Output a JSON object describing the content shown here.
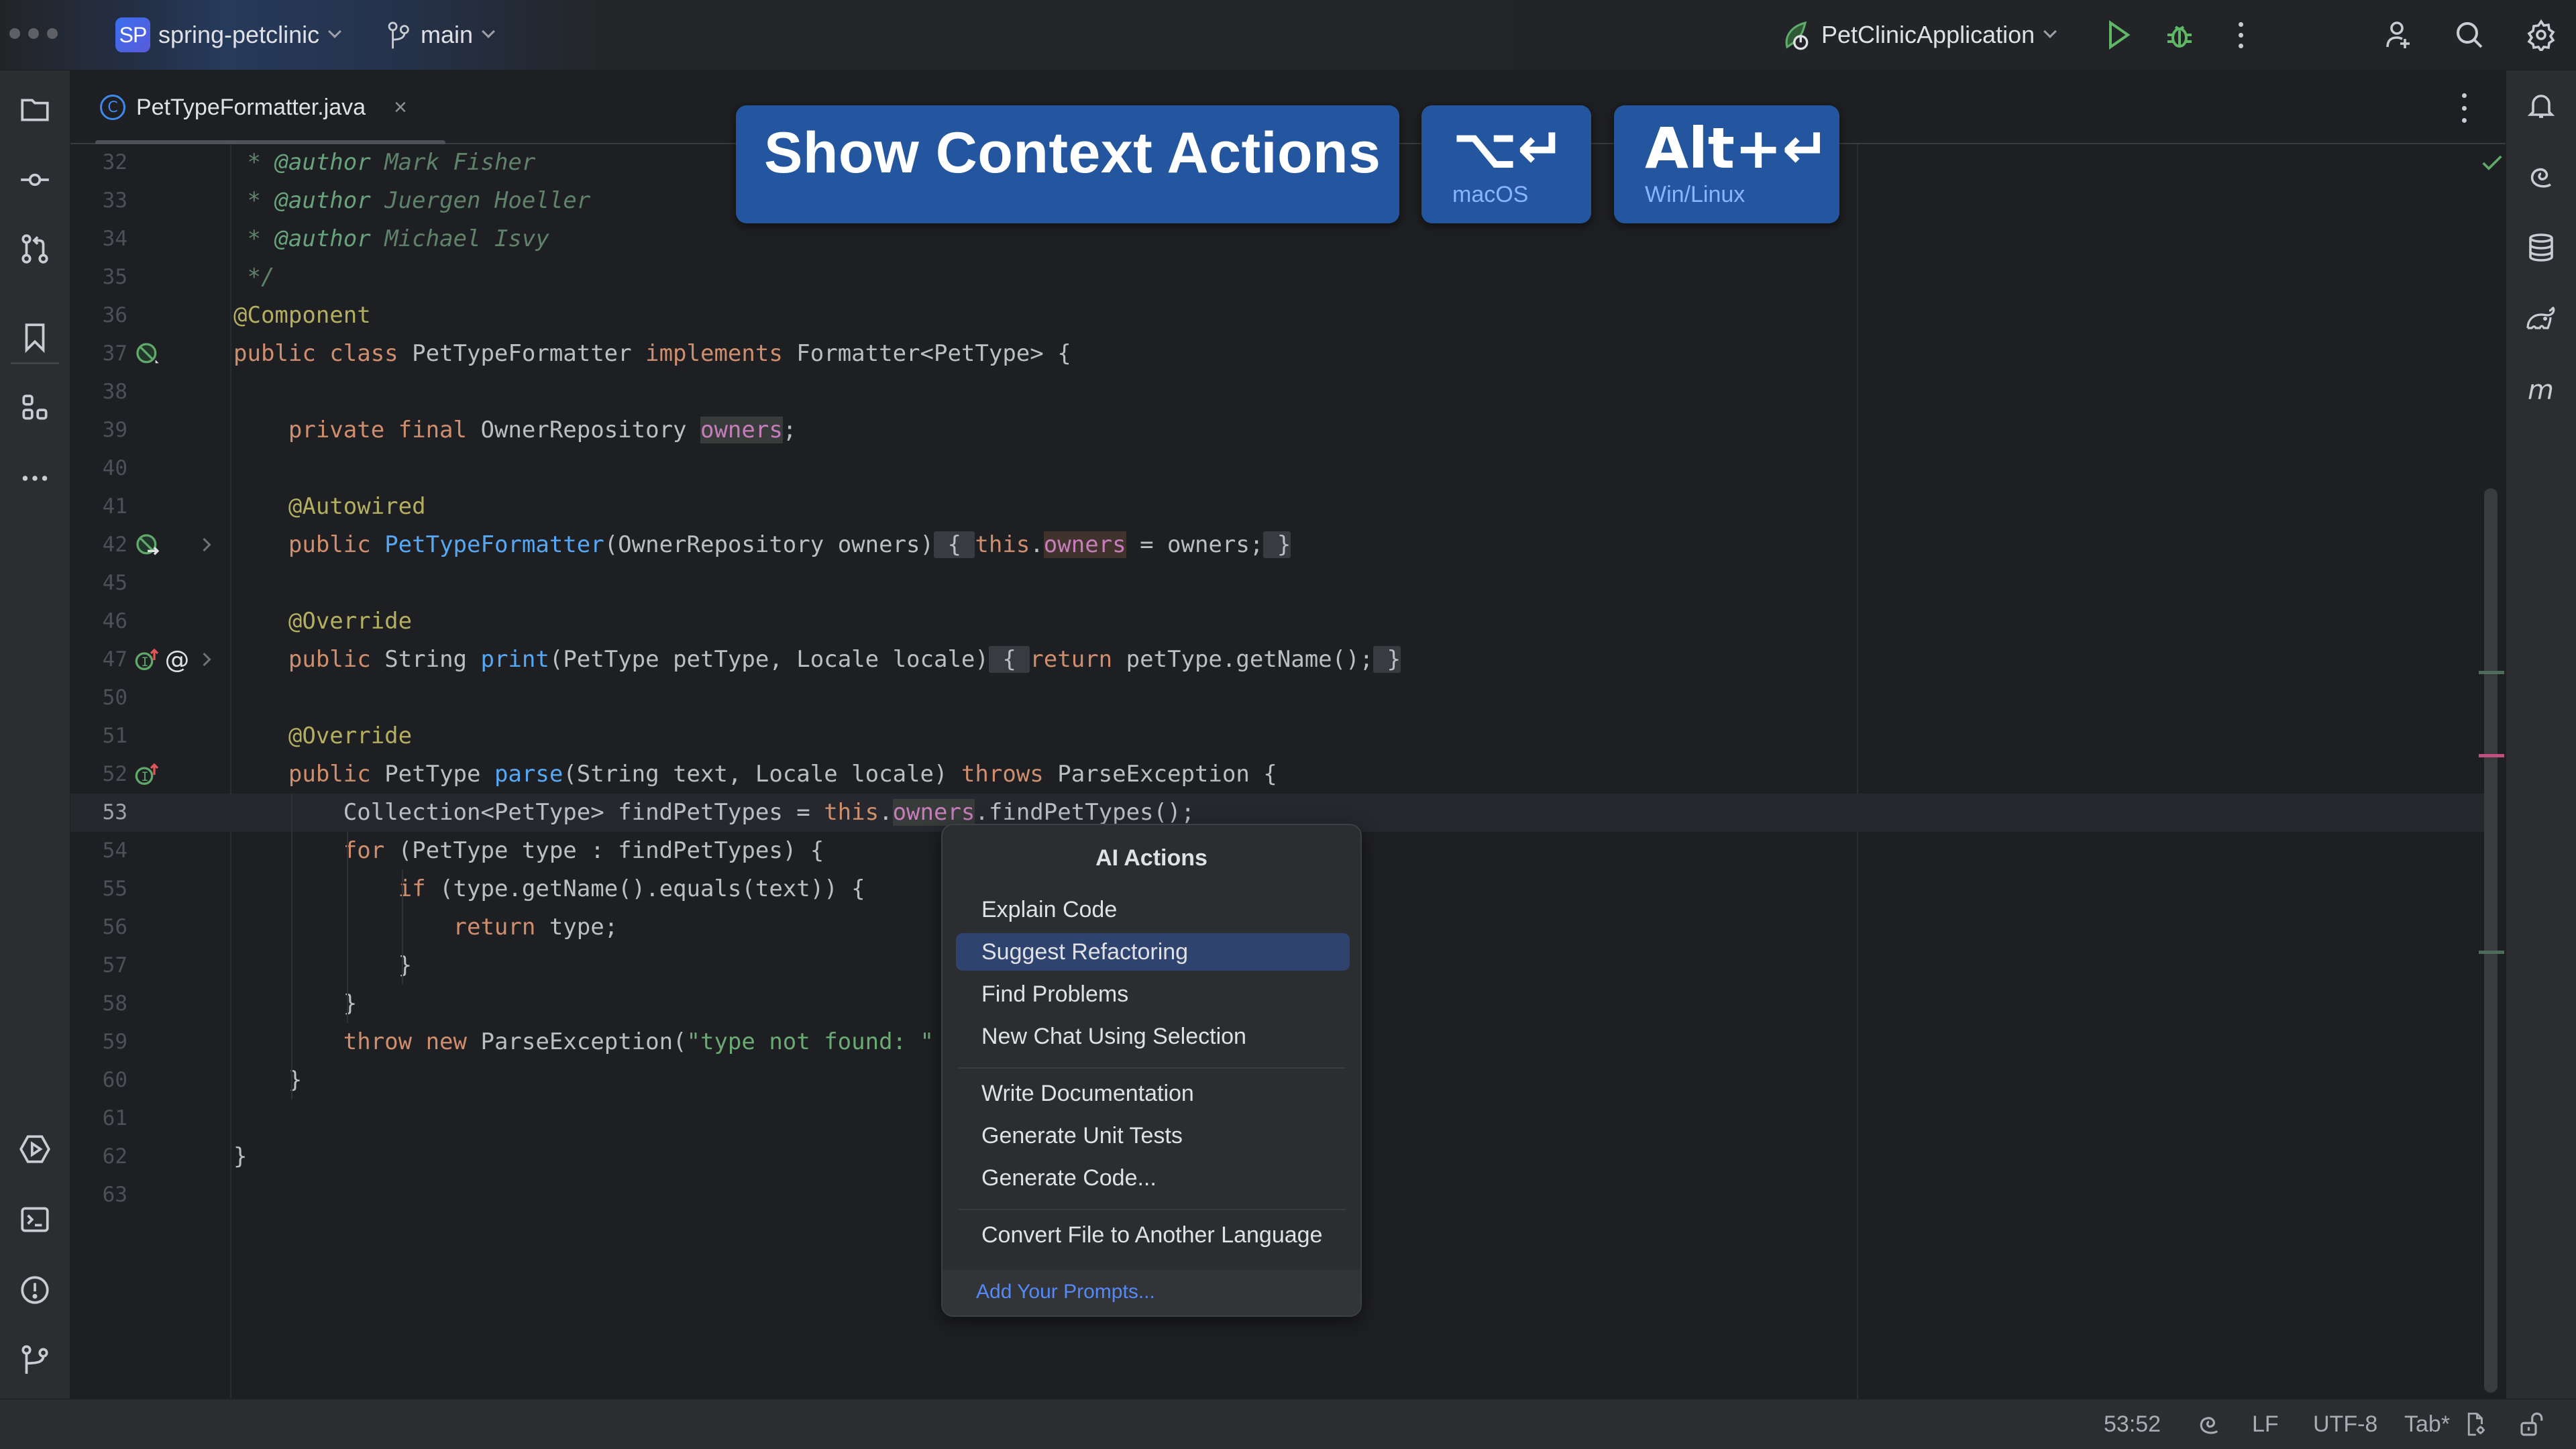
{
  "titlebar": {
    "project_badge": "SP",
    "project_name": "spring-petclinic",
    "branch": "main",
    "run_config": "PetClinicApplication",
    "icons": [
      "run-icon",
      "debug-icon",
      "more-vertical-icon",
      "add-user-icon",
      "search-icon",
      "settings-gear-icon"
    ]
  },
  "left_toolbar": {
    "top": [
      "project-folder-icon",
      "commit-icon",
      "pull-requests-icon",
      "bookmarks-icon",
      "structure-icon",
      "more-tools-icon"
    ],
    "bottom": [
      "run-services-icon",
      "terminal-icon",
      "problems-icon",
      "git-icon"
    ]
  },
  "right_toolbar": [
    "notifications-bell-icon",
    "ai-assistant-icon",
    "database-icon",
    "gradle-icon",
    "maven-icon"
  ],
  "editor": {
    "tab": {
      "icon": "C",
      "filename": "PetTypeFormatter.java",
      "close": "×"
    },
    "current_line": "53",
    "lines": [
      {
        "n": "32",
        "tokens": [
          [
            "cm",
            " * "
          ],
          [
            "cmtag",
            "@author"
          ],
          [
            "cm",
            " Mark Fisher"
          ]
        ]
      },
      {
        "n": "33",
        "tokens": [
          [
            "cm",
            " * "
          ],
          [
            "cmtag",
            "@author"
          ],
          [
            "cm",
            " Juergen Hoeller"
          ]
        ]
      },
      {
        "n": "34",
        "tokens": [
          [
            "cm",
            " * "
          ],
          [
            "cmtag",
            "@author"
          ],
          [
            "cm",
            " Michael Isvy"
          ]
        ]
      },
      {
        "n": "35",
        "tokens": [
          [
            "cm",
            " */"
          ]
        ]
      },
      {
        "n": "36",
        "tokens": [
          [
            "an",
            "@Component"
          ]
        ]
      },
      {
        "n": "37",
        "gutter": [
          "bean-icon"
        ],
        "tokens": [
          [
            "k",
            "public class "
          ],
          [
            "",
            "PetTypeFormatter "
          ],
          [
            "k",
            "implements "
          ],
          [
            "",
            "Formatter<PetType> {"
          ]
        ]
      },
      {
        "n": "38",
        "tokens": []
      },
      {
        "n": "39",
        "tokens": [
          [
            "",
            "    "
          ],
          [
            "k",
            "private final "
          ],
          [
            "",
            "OwnerRepository "
          ],
          [
            "fld hl-read",
            "owners"
          ],
          [
            "",
            ";"
          ]
        ]
      },
      {
        "n": "40",
        "tokens": []
      },
      {
        "n": "41",
        "tokens": [
          [
            "",
            "    "
          ],
          [
            "an",
            "@Autowired"
          ]
        ]
      },
      {
        "n": "42",
        "gutter": [
          "bean-inject-icon"
        ],
        "fold": true,
        "tokens": [
          [
            "",
            "    "
          ],
          [
            "k",
            "public "
          ],
          [
            "fn",
            "PetTypeFormatter"
          ],
          [
            "",
            "(OwnerRepository owners)"
          ],
          [
            "hl-fold",
            " { "
          ],
          [
            "k",
            "this"
          ],
          [
            "",
            "."
          ],
          [
            "fld hl-write",
            "owners"
          ],
          [
            "",
            " = owners;"
          ],
          [
            "hl-fold",
            " }"
          ]
        ]
      },
      {
        "n": "45",
        "tokens": []
      },
      {
        "n": "46",
        "tokens": [
          [
            "",
            "    "
          ],
          [
            "an",
            "@Override"
          ]
        ]
      },
      {
        "n": "47",
        "gutter": [
          "implements-icon",
          "annotation-icon"
        ],
        "fold": true,
        "tokens": [
          [
            "",
            "    "
          ],
          [
            "k",
            "public "
          ],
          [
            "",
            "String "
          ],
          [
            "fn",
            "print"
          ],
          [
            "",
            "(PetType petType, Locale locale)"
          ],
          [
            "hl-fold",
            " { "
          ],
          [
            "k",
            "return "
          ],
          [
            "",
            "petType.getName();"
          ],
          [
            "hl-fold",
            " }"
          ]
        ]
      },
      {
        "n": "50",
        "tokens": []
      },
      {
        "n": "51",
        "tokens": [
          [
            "",
            "    "
          ],
          [
            "an",
            "@Override"
          ]
        ]
      },
      {
        "n": "52",
        "gutter": [
          "implements-icon"
        ],
        "tokens": [
          [
            "",
            "    "
          ],
          [
            "k",
            "public "
          ],
          [
            "",
            "PetType "
          ],
          [
            "fn",
            "parse"
          ],
          [
            "",
            "(String text, Locale locale) "
          ],
          [
            "k",
            "throws "
          ],
          [
            "",
            "ParseException {"
          ]
        ]
      },
      {
        "n": "53",
        "tokens": [
          [
            "",
            "        Collection<PetType> findPetTypes = "
          ],
          [
            "k",
            "this"
          ],
          [
            "",
            "."
          ],
          [
            "fld hl-read",
            "owners"
          ],
          [
            "",
            ".findPetTypes();"
          ]
        ]
      },
      {
        "n": "54",
        "tokens": [
          [
            "",
            "        "
          ],
          [
            "k",
            "for "
          ],
          [
            "",
            "(PetType type : findPetTypes) {"
          ]
        ]
      },
      {
        "n": "55",
        "tokens": [
          [
            "",
            "            "
          ],
          [
            "k",
            "if "
          ],
          [
            "",
            "(type.getName().equals(text)) {"
          ]
        ]
      },
      {
        "n": "56",
        "tokens": [
          [
            "",
            "                "
          ],
          [
            "k",
            "return "
          ],
          [
            "",
            "type;"
          ]
        ]
      },
      {
        "n": "57",
        "tokens": [
          [
            "",
            "            }"
          ]
        ]
      },
      {
        "n": "58",
        "tokens": [
          [
            "",
            "        }"
          ]
        ]
      },
      {
        "n": "59",
        "tokens": [
          [
            "",
            "        "
          ],
          [
            "k",
            "throw new "
          ],
          [
            "",
            "ParseException("
          ],
          [
            "str",
            "\"type not found: \""
          ]
        ]
      },
      {
        "n": "60",
        "tokens": [
          [
            "",
            "    }"
          ]
        ]
      },
      {
        "n": "61",
        "tokens": []
      },
      {
        "n": "62",
        "tokens": [
          [
            "",
            "}"
          ]
        ]
      },
      {
        "n": "63",
        "tokens": []
      }
    ]
  },
  "overlay": {
    "title": "Show Context Actions",
    "mac_shortcut": "⌥↵",
    "mac_label": "macOS",
    "win_shortcut": "Alt+↵",
    "win_label": "Win/Linux"
  },
  "ai_popup": {
    "title": "AI Actions",
    "groups": [
      [
        "Explain Code",
        "Suggest Refactoring",
        "Find Problems",
        "New Chat Using Selection"
      ],
      [
        "Write Documentation",
        "Generate Unit Tests",
        "Generate Code..."
      ],
      [
        "Convert File to Another Language"
      ]
    ],
    "selected": "Suggest Refactoring",
    "footer": "Add Your Prompts..."
  },
  "statusbar": {
    "position": "53:52",
    "line_separator": "LF",
    "encoding": "UTF-8",
    "indent": "Tab*"
  },
  "colors": {
    "accent": "#2456a0",
    "selection": "#2e436e",
    "link": "#548af7",
    "keyword": "#cf8e6d",
    "annotation": "#b3ae60",
    "function": "#56a8f5",
    "field": "#c77dbb",
    "string": "#6aab73",
    "comment": "#5f826b"
  }
}
